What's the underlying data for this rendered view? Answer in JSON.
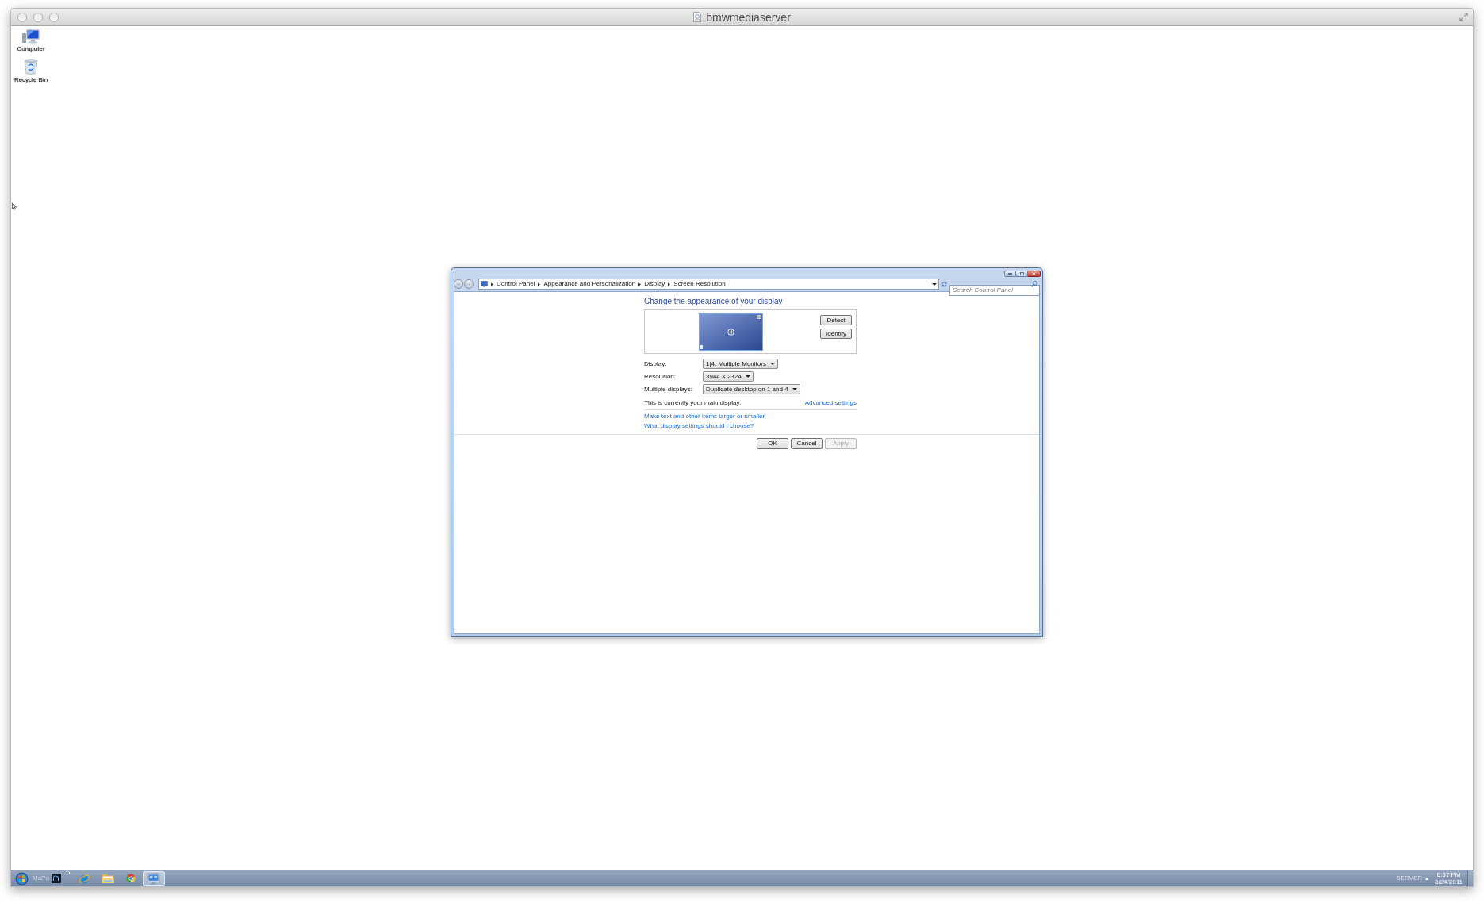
{
  "host_window": {
    "title": "bmwmediaserver"
  },
  "desktop_icons": [
    {
      "kind": "computer",
      "label": "Computer"
    },
    {
      "kind": "bin",
      "label": "Recycle Bin"
    }
  ],
  "dialog": {
    "breadcrumb": [
      "Control Panel",
      "Appearance and Personalization",
      "Display",
      "Screen Resolution"
    ],
    "search": {
      "placeholder": "Search Control Panel"
    },
    "heading": "Change the appearance of your display",
    "preview_buttons": [
      "Detect",
      "Identify"
    ],
    "fields": [
      {
        "label": "Display:",
        "value": "1|4. Multiple Monitors"
      },
      {
        "label": "Resolution:",
        "value": "3944 × 2324"
      },
      {
        "label": "Multiple displays:",
        "value": "Duplicate desktop on 1 and 4"
      }
    ],
    "status": "This is currently your main display.",
    "advanced_link": "Advanced settings",
    "links": [
      "Make text and other items larger or smaller",
      "What display settings should I choose?"
    ],
    "buttons": [
      {
        "label": "OK",
        "disabled": false
      },
      {
        "label": "Cancel",
        "disabled": false
      },
      {
        "label": "Apply",
        "disabled": true
      }
    ]
  },
  "taskbar": {
    "toolbar_label": "MaPo",
    "buttons": [
      {
        "kind": "browser",
        "selected": false
      },
      {
        "kind": "folder",
        "selected": false
      },
      {
        "kind": "ring",
        "selected": false
      },
      {
        "kind": "screen",
        "selected": true
      }
    ],
    "tray_label": "SERVER",
    "time": "6:37 PM",
    "date": "8/24/2011"
  }
}
